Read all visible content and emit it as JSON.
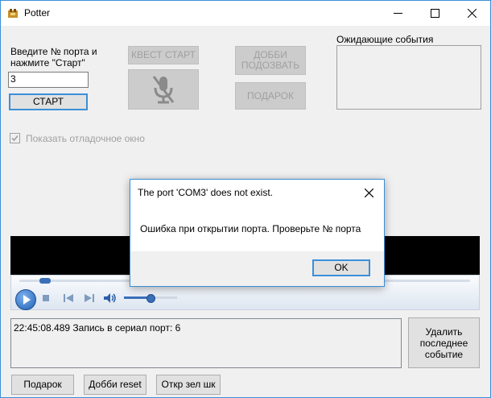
{
  "window": {
    "title": "Potter"
  },
  "port_panel": {
    "prompt": "Введите № порта и нажмите \"Старт\"",
    "port_value": "3",
    "start_label": "СТАРТ"
  },
  "buttons": {
    "quest_start": "КВЕСТ СТАРТ",
    "dobby_call": "ДОББИ ПОДОЗВАТЬ",
    "gift": "ПОДАРОК"
  },
  "debug_checkbox": {
    "label": "Показать отладочное окно",
    "checked": true
  },
  "pending_events": {
    "title": "Ожидающие события"
  },
  "log": {
    "text": "22:45:08.489 Запись в сериал порт: 6"
  },
  "delete_event_label": "Удалить последнее событие",
  "bottom_buttons": [
    "Подарок",
    "Добби reset",
    "Откр зел шк"
  ],
  "dialog": {
    "title": "The port 'COM3' does not exist.",
    "message": "Ошибка при открытии порта. Проверьте № порта",
    "ok_label": "OK"
  },
  "player": {
    "volume_level": 0.55,
    "progress": 0.02
  },
  "colors": {
    "accent_blue": "#3c8fd8",
    "disabled_gray": "#cccccc",
    "video_black": "#000000"
  }
}
